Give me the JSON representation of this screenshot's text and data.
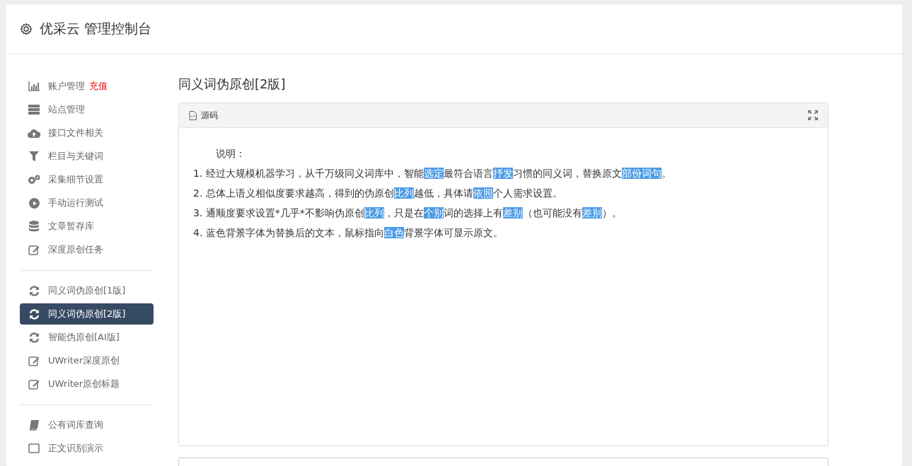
{
  "header": {
    "title": "优采云 管理控制台"
  },
  "sidebar": {
    "groups": [
      {
        "items": [
          {
            "kind": "chart",
            "label": "账户管理",
            "badge": "充值",
            "selected": false
          },
          {
            "kind": "server",
            "label": "站点管理",
            "selected": false
          },
          {
            "kind": "cloud",
            "label": "接口文件相关",
            "selected": false
          },
          {
            "kind": "filter",
            "label": "栏目与关键词",
            "selected": false
          },
          {
            "kind": "gears",
            "label": "采集细节设置",
            "selected": false
          },
          {
            "kind": "play",
            "label": "手动运行测试",
            "selected": false
          },
          {
            "kind": "database",
            "label": "文章暂存库",
            "selected": false
          },
          {
            "kind": "edit",
            "label": "深度原创任务",
            "selected": false
          }
        ]
      },
      {
        "items": [
          {
            "kind": "refresh",
            "label": "同义词伪原创[1版]",
            "selected": false
          },
          {
            "kind": "refresh",
            "label": "同义词伪原创[2版]",
            "selected": true
          },
          {
            "kind": "refresh",
            "label": "智能伪原创[AI版]",
            "selected": false
          },
          {
            "kind": "edit",
            "label": "UWriter深度原创",
            "selected": false
          },
          {
            "kind": "edit",
            "label": "UWriter原创标题",
            "selected": false
          }
        ]
      },
      {
        "items": [
          {
            "kind": "book",
            "label": "公有词库查询",
            "selected": false
          },
          {
            "kind": "window",
            "label": "正文识别演示",
            "selected": false
          }
        ]
      }
    ]
  },
  "main": {
    "title": "同义词伪原创[2版]",
    "panel": {
      "tab": "源码",
      "lines": [
        {
          "kind": "heading",
          "segments": [
            {
              "text": "说明：",
              "highlighted": false
            }
          ]
        },
        {
          "kind": "item",
          "segments": [
            {
              "text": "1. 经过大规模机器学习，从千万级同义词库中，智能",
              "highlighted": false
            },
            {
              "text": "选定",
              "highlighted": true
            },
            {
              "text": "最符合语言",
              "highlighted": false
            },
            {
              "text": "抒发",
              "highlighted": true
            },
            {
              "text": "习惯的同义词，替换原文",
              "highlighted": false
            },
            {
              "text": "部份",
              "highlighted": true
            },
            {
              "text": "词句",
              "highlighted": true
            },
            {
              "text": "。",
              "highlighted": false
            }
          ]
        },
        {
          "kind": "item",
          "segments": [
            {
              "text": "2. 总体上语义相似度要求越高，得到的伪原创",
              "highlighted": false
            },
            {
              "text": "比列",
              "highlighted": true
            },
            {
              "text": "越低，具体请",
              "highlighted": false
            },
            {
              "text": "依照",
              "highlighted": true
            },
            {
              "text": "个人需求设置。",
              "highlighted": false
            }
          ]
        },
        {
          "kind": "item",
          "segments": [
            {
              "text": "3. 通顺度要求设置*几乎*不影响伪原创",
              "highlighted": false
            },
            {
              "text": "比列",
              "highlighted": true
            },
            {
              "text": "，只是在",
              "highlighted": false
            },
            {
              "text": "个别",
              "highlighted": true
            },
            {
              "text": "词的选择上有",
              "highlighted": false
            },
            {
              "text": "差别",
              "highlighted": true
            },
            {
              "text": "（也可能没有",
              "highlighted": false
            },
            {
              "text": "差别",
              "highlighted": true
            },
            {
              "text": "）。",
              "highlighted": false
            }
          ]
        },
        {
          "kind": "item",
          "segments": [
            {
              "text": "4. 蓝色背景字体为替换后的文本，鼠标指向",
              "highlighted": false
            },
            {
              "text": "白色",
              "highlighted": true
            },
            {
              "text": "背景字体可显示原文。",
              "highlighted": false
            }
          ]
        }
      ]
    }
  }
}
